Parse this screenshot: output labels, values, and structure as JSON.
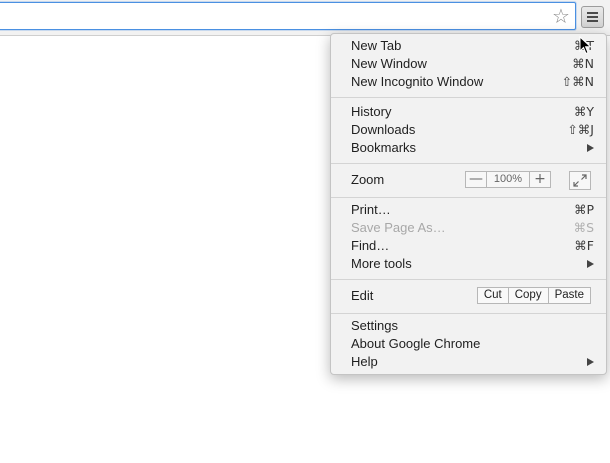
{
  "toolbar": {
    "star_icon": "star-outline-icon",
    "menu_icon": "hamburger-menu-icon"
  },
  "menu": {
    "group1": [
      {
        "label": "New Tab",
        "shortcut": "⌘T"
      },
      {
        "label": "New Window",
        "shortcut": "⌘N"
      },
      {
        "label": "New Incognito Window",
        "shortcut": "⇧⌘N"
      }
    ],
    "group2": [
      {
        "label": "History",
        "shortcut": "⌘Y"
      },
      {
        "label": "Downloads",
        "shortcut": "⇧⌘J"
      },
      {
        "label": "Bookmarks",
        "submenu": true
      }
    ],
    "zoom": {
      "label": "Zoom",
      "minus": "—",
      "value": "100%",
      "plus": "+"
    },
    "group3": [
      {
        "label": "Print…",
        "shortcut": "⌘P"
      },
      {
        "label": "Save Page As…",
        "shortcut": "⌘S",
        "disabled": true
      },
      {
        "label": "Find…",
        "shortcut": "⌘F"
      },
      {
        "label": "More tools",
        "submenu": true
      }
    ],
    "edit": {
      "label": "Edit",
      "cut": "Cut",
      "copy": "Copy",
      "paste": "Paste"
    },
    "group4": [
      {
        "label": "Settings"
      },
      {
        "label": "About Google Chrome"
      },
      {
        "label": "Help",
        "submenu": true
      }
    ]
  },
  "colors": {
    "omnibox_focus": "#4a90e2",
    "menu_bg": "#f2f2f2",
    "disabled_text": "#a8a8a8"
  }
}
